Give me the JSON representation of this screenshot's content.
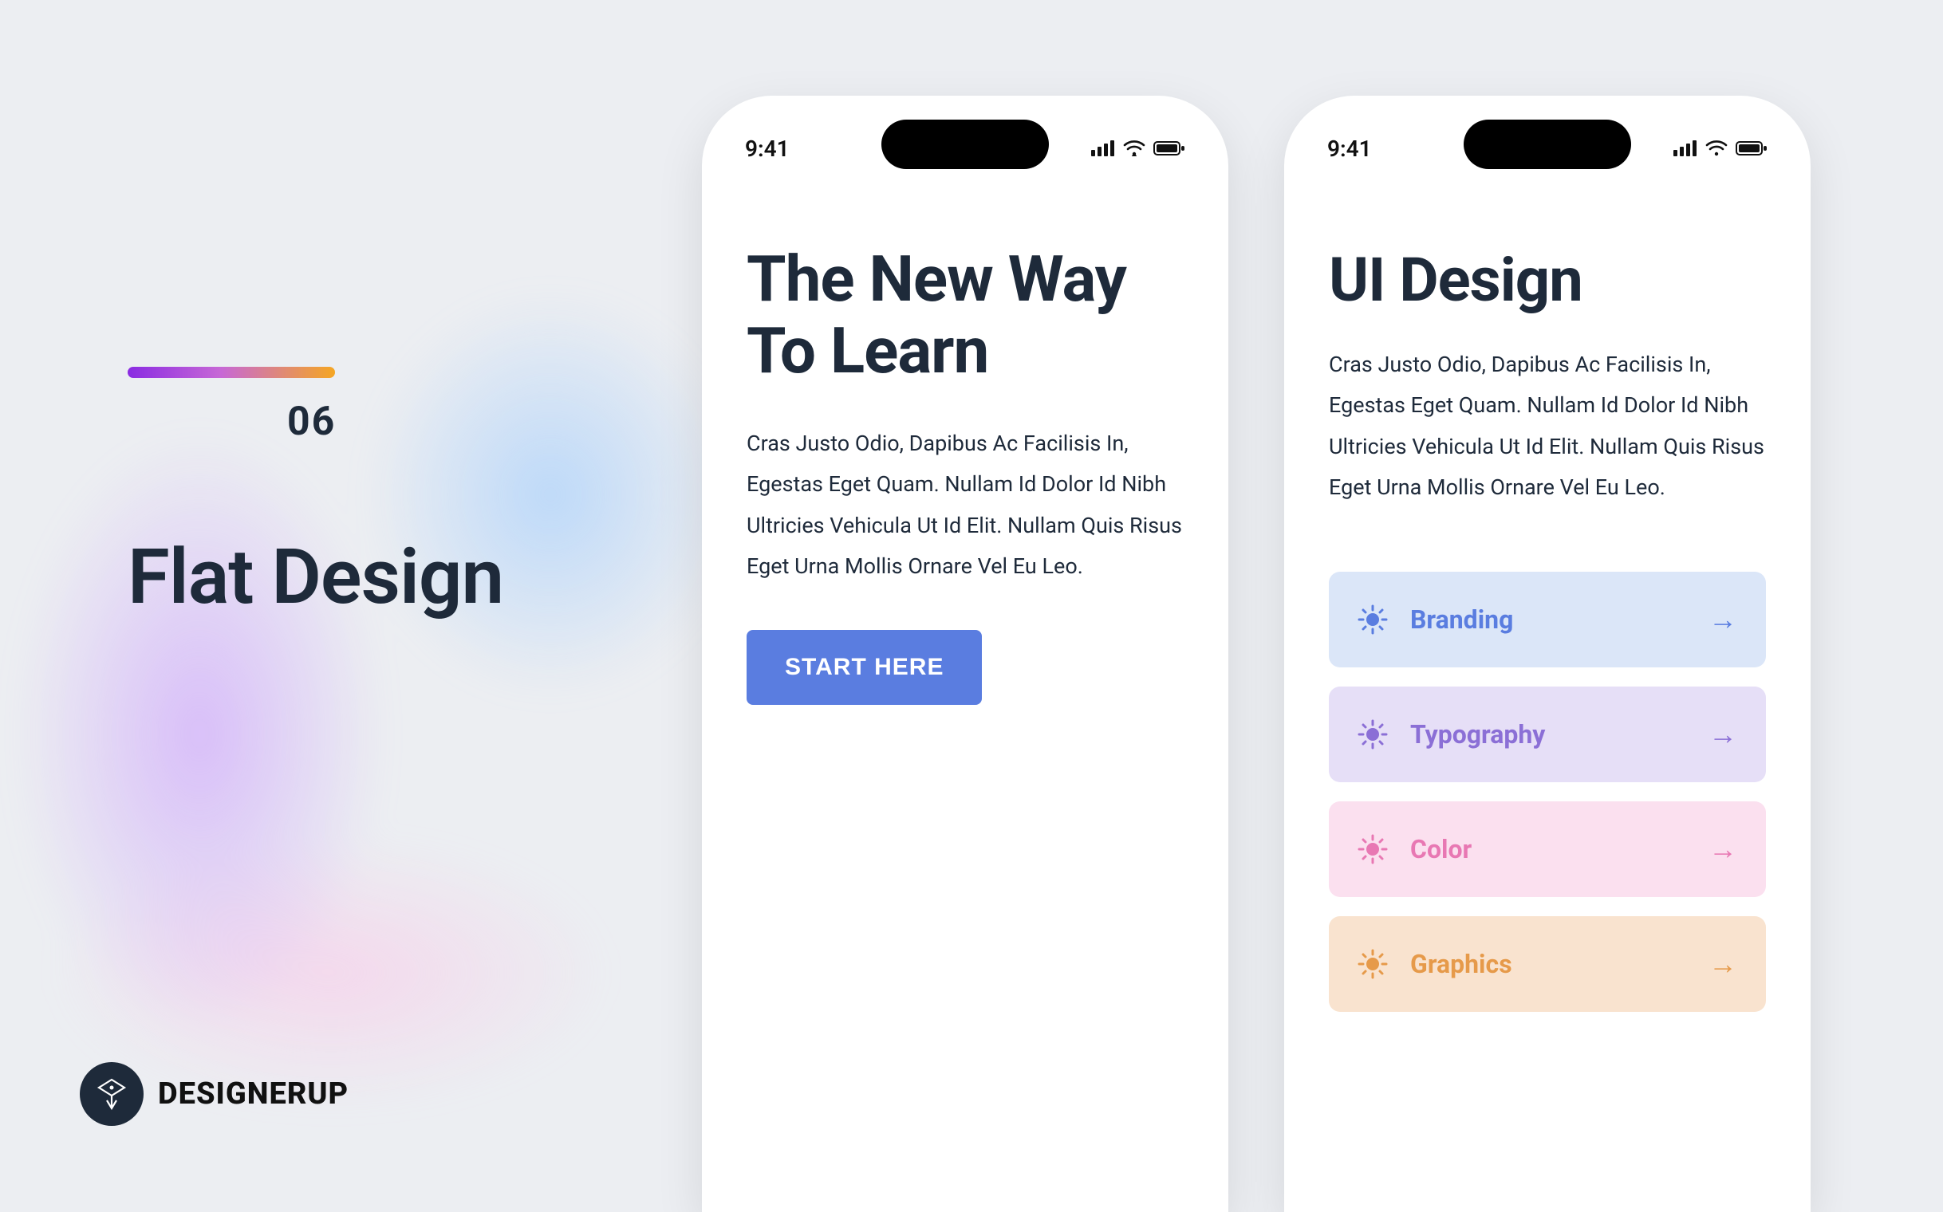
{
  "slide": {
    "number": "06",
    "title": "Flat Design"
  },
  "brand": {
    "name": "DESIGNERUP"
  },
  "status": {
    "time": "9:41"
  },
  "phone1": {
    "title": "The New Way To Learn",
    "body": "Cras Justo Odio, Dapibus Ac Facilisis In, Egestas Eget Quam. Nullam Id Dolor Id Nibh Ultricies Vehicula Ut Id Elit. Nullam Quis Risus Eget Urna Mollis Ornare Vel Eu Leo.",
    "cta": "START HERE"
  },
  "phone2": {
    "title": "UI Design",
    "body": "Cras Justo Odio, Dapibus Ac Facilisis In, Egestas Eget Quam. Nullam Id Dolor Id Nibh Ultricies Vehicula Ut Id Elit. Nullam Quis Risus Eget Urna Mollis Ornare Vel Eu Leo.",
    "categories": [
      {
        "label": "Branding"
      },
      {
        "label": "Typography"
      },
      {
        "label": "Color"
      },
      {
        "label": "Graphics"
      }
    ]
  }
}
